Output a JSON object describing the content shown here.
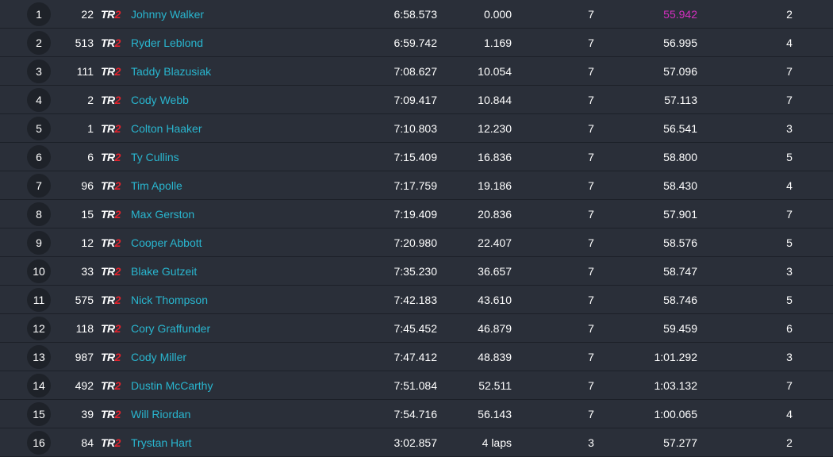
{
  "colors": {
    "background": "#272c36",
    "rider_name": "#29b6cf",
    "fastest_lap": "#d42fbf",
    "logo_accent": "#e0222c"
  },
  "logo": {
    "prefix": "TR",
    "suffix": "2"
  },
  "rows": [
    {
      "pos": "1",
      "number": "22",
      "name": "Johnny Walker",
      "total_time": "6:58.573",
      "gap": "0.000",
      "laps": "7",
      "best_lap_time": "55.942",
      "best_lap": "2",
      "fastest": true
    },
    {
      "pos": "2",
      "number": "513",
      "name": "Ryder Leblond",
      "total_time": "6:59.742",
      "gap": "1.169",
      "laps": "7",
      "best_lap_time": "56.995",
      "best_lap": "4"
    },
    {
      "pos": "3",
      "number": "111",
      "name": "Taddy Blazusiak",
      "total_time": "7:08.627",
      "gap": "10.054",
      "laps": "7",
      "best_lap_time": "57.096",
      "best_lap": "7"
    },
    {
      "pos": "4",
      "number": "2",
      "name": "Cody Webb",
      "total_time": "7:09.417",
      "gap": "10.844",
      "laps": "7",
      "best_lap_time": "57.113",
      "best_lap": "7"
    },
    {
      "pos": "5",
      "number": "1",
      "name": "Colton Haaker",
      "total_time": "7:10.803",
      "gap": "12.230",
      "laps": "7",
      "best_lap_time": "56.541",
      "best_lap": "3"
    },
    {
      "pos": "6",
      "number": "6",
      "name": "Ty Cullins",
      "total_time": "7:15.409",
      "gap": "16.836",
      "laps": "7",
      "best_lap_time": "58.800",
      "best_lap": "5"
    },
    {
      "pos": "7",
      "number": "96",
      "name": "Tim Apolle",
      "total_time": "7:17.759",
      "gap": "19.186",
      "laps": "7",
      "best_lap_time": "58.430",
      "best_lap": "4"
    },
    {
      "pos": "8",
      "number": "15",
      "name": "Max Gerston",
      "total_time": "7:19.409",
      "gap": "20.836",
      "laps": "7",
      "best_lap_time": "57.901",
      "best_lap": "7"
    },
    {
      "pos": "9",
      "number": "12",
      "name": "Cooper Abbott",
      "total_time": "7:20.980",
      "gap": "22.407",
      "laps": "7",
      "best_lap_time": "58.576",
      "best_lap": "5"
    },
    {
      "pos": "10",
      "number": "33",
      "name": "Blake Gutzeit",
      "total_time": "7:35.230",
      "gap": "36.657",
      "laps": "7",
      "best_lap_time": "58.747",
      "best_lap": "3"
    },
    {
      "pos": "11",
      "number": "575",
      "name": "Nick Thompson",
      "total_time": "7:42.183",
      "gap": "43.610",
      "laps": "7",
      "best_lap_time": "58.746",
      "best_lap": "5"
    },
    {
      "pos": "12",
      "number": "118",
      "name": "Cory Graffunder",
      "total_time": "7:45.452",
      "gap": "46.879",
      "laps": "7",
      "best_lap_time": "59.459",
      "best_lap": "6"
    },
    {
      "pos": "13",
      "number": "987",
      "name": "Cody Miller",
      "total_time": "7:47.412",
      "gap": "48.839",
      "laps": "7",
      "best_lap_time": "1:01.292",
      "best_lap": "3"
    },
    {
      "pos": "14",
      "number": "492",
      "name": "Dustin McCarthy",
      "total_time": "7:51.084",
      "gap": "52.511",
      "laps": "7",
      "best_lap_time": "1:03.132",
      "best_lap": "7"
    },
    {
      "pos": "15",
      "number": "39",
      "name": "Will Riordan",
      "total_time": "7:54.716",
      "gap": "56.143",
      "laps": "7",
      "best_lap_time": "1:00.065",
      "best_lap": "4"
    },
    {
      "pos": "16",
      "number": "84",
      "name": "Trystan Hart",
      "total_time": "3:02.857",
      "gap": "4 laps",
      "laps": "3",
      "best_lap_time": "57.277",
      "best_lap": "2"
    }
  ]
}
